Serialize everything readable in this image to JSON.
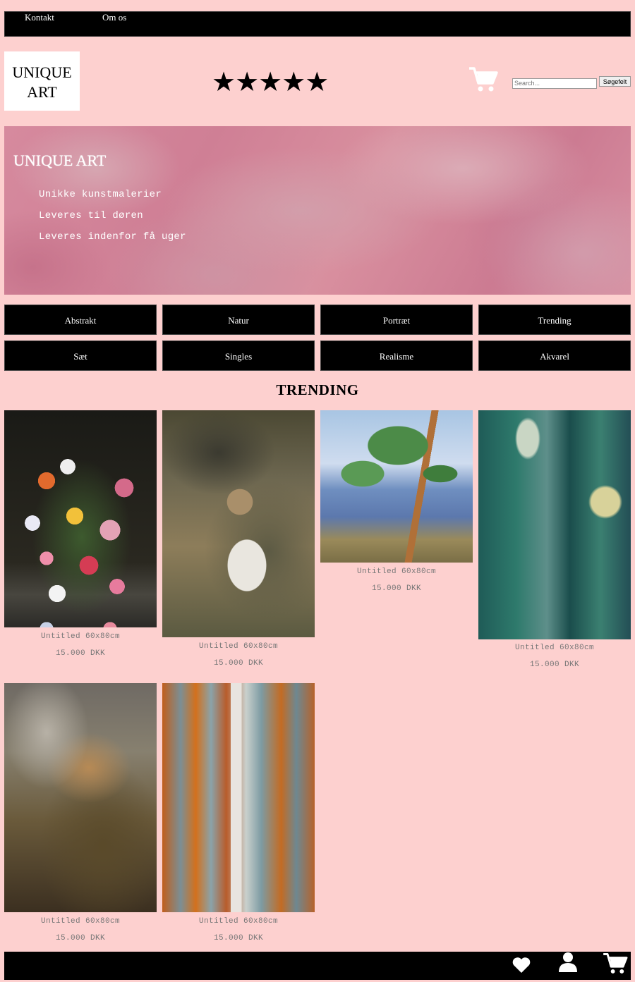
{
  "topnav": {
    "links": [
      "Kontakt",
      "Om os"
    ]
  },
  "logo": {
    "line1": "UNIQUE",
    "line2": "ART"
  },
  "rating": {
    "stars": "★★★★★",
    "value": 5,
    "max": 5
  },
  "search": {
    "placeholder": "Search...",
    "button_label": "Søgefelt"
  },
  "hero": {
    "title": "UNIQUE ART",
    "lines": [
      "Unikke kunstmalerier",
      "Leveres til døren",
      "Leveres indenfor få uger"
    ]
  },
  "categories": [
    "Abstrakt",
    "Natur",
    "Portræt",
    "Trending",
    "Sæt",
    "Singles",
    "Realisme",
    "Akvarel"
  ],
  "trending": {
    "title": "TRENDING",
    "products": [
      {
        "title": "Untitled 60x80cm",
        "price": "15.000 DKK"
      },
      {
        "title": "Untitled 60x80cm",
        "price": "15.000 DKK"
      },
      {
        "title": "Untitled 60x80cm",
        "price": "15.000 DKK"
      },
      {
        "title": "Untitled 60x80cm",
        "price": "15.000 DKK"
      },
      {
        "title": "Untitled 60x80cm",
        "price": "15.000 DKK"
      },
      {
        "title": "Untitled 60x80cm",
        "price": "15.000 DKK"
      }
    ]
  },
  "icons": {
    "top_cart": "cart-icon",
    "footer": [
      "heart-icon",
      "user-icon",
      "cart-icon"
    ]
  },
  "colors": {
    "background": "#fdd0cf",
    "bars": "#000000",
    "hero": "#d68a9e"
  }
}
